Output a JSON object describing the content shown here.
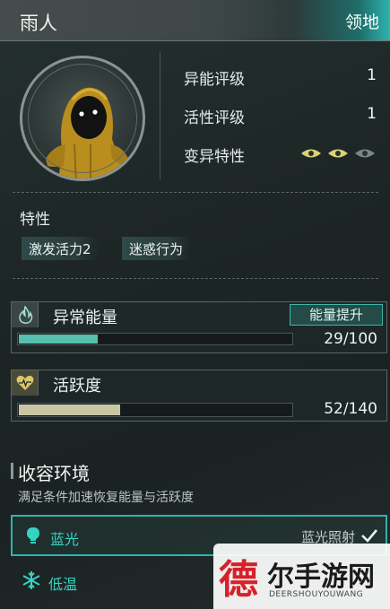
{
  "header": {
    "title": "雨人",
    "domain_button": "领地"
  },
  "stats": [
    {
      "label": "异能评级",
      "value": "1"
    },
    {
      "label": "活性评级",
      "value": "1"
    },
    {
      "label": "变异特性",
      "value": ""
    }
  ],
  "mutation_eyes": {
    "active": 2,
    "total": 3,
    "active_color": "#d9d27a",
    "inactive_color": "#7b8584"
  },
  "traits": {
    "title": "特性",
    "tags": [
      "激发活力2",
      "迷惑行为"
    ]
  },
  "energy": {
    "title": "异常能量",
    "button": "能量提升",
    "display": "29/100",
    "current": 29,
    "max": 100,
    "fill_color": "#55c0ad"
  },
  "activity": {
    "title": "活跃度",
    "display": "52/140",
    "current": 52,
    "max": 140,
    "fill_color": "#c9c6a3"
  },
  "containment": {
    "title": "收容环境",
    "subtitle": "满足条件加速恢复能量与活跃度",
    "items": [
      {
        "name": "蓝光",
        "state": "蓝光照射",
        "selected": true
      },
      {
        "name": "低温",
        "state": "",
        "selected": false
      }
    ]
  },
  "watermark": {
    "char": "德",
    "text": "尔手游网",
    "sub": "DEERSHOUYOUWANG"
  },
  "accent_color": "#2fb3ad"
}
